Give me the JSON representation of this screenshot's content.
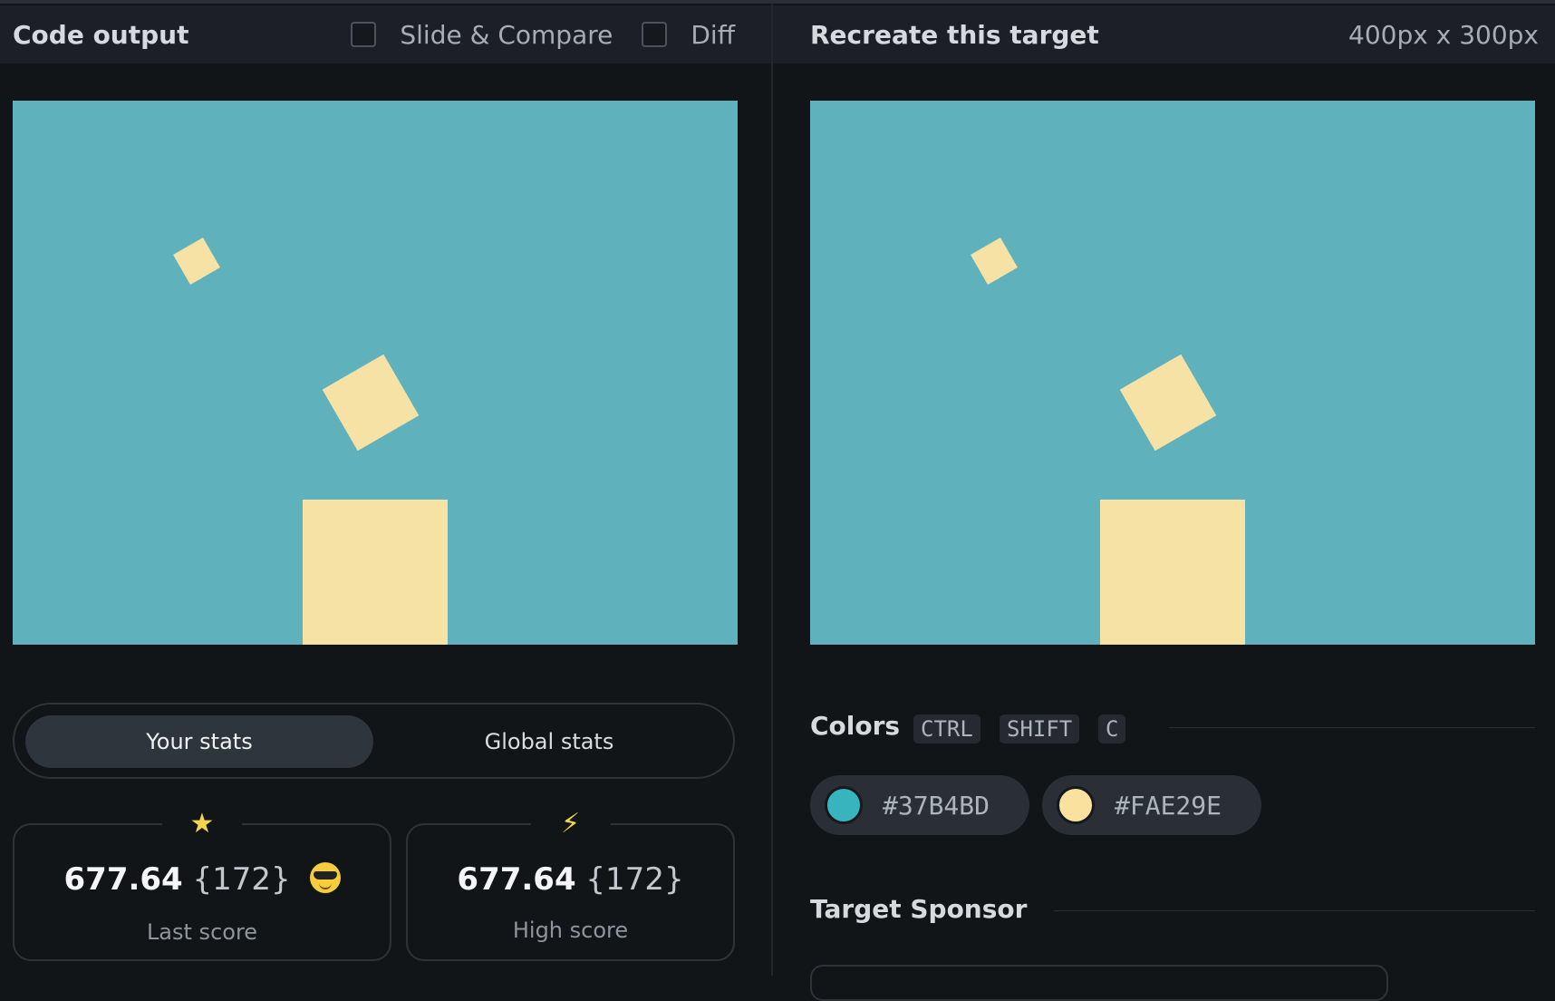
{
  "header_left": {
    "title": "Code output",
    "slide_compare_label": "Slide & Compare",
    "diff_label": "Diff"
  },
  "header_right": {
    "title": "Recreate this target",
    "dimensions": "400px x 300px"
  },
  "stats_toggle": {
    "your_stats": "Your stats",
    "global_stats": "Global stats"
  },
  "last_score": {
    "icon": "star-icon",
    "icon_glyph": "★",
    "value": "677.64",
    "chars": "{172}",
    "label": "Last score"
  },
  "high_score": {
    "icon": "lightning-icon",
    "icon_glyph": "⚡",
    "value": "677.64",
    "chars": "{172}",
    "label": "High score"
  },
  "colors": {
    "title": "Colors",
    "shortcut": [
      "CTRL",
      "SHIFT",
      "C"
    ],
    "swatches": [
      {
        "hex": "#37B4BD",
        "label": "#37B4BD"
      },
      {
        "hex": "#FAE29E",
        "label": "#FAE29E"
      }
    ]
  },
  "sponsor": {
    "title": "Target Sponsor"
  }
}
